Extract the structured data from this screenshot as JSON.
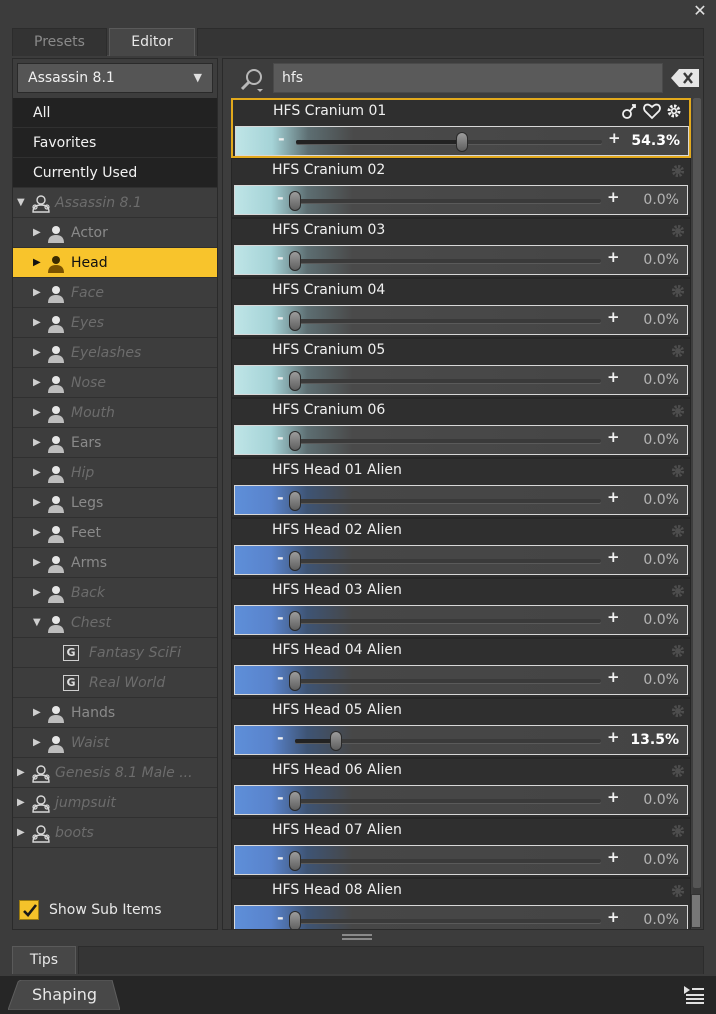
{
  "window": {
    "close_glyph": "✕"
  },
  "tabs": {
    "presets": "Presets",
    "editor": "Editor"
  },
  "figure_selector": {
    "selected": "Assassin 8.1"
  },
  "tree": {
    "top_items": [
      "All",
      "Favorites",
      "Currently Used"
    ],
    "nodes": [
      {
        "label": "Assassin 8.1",
        "icon": "figure-outline-icon",
        "level": 0,
        "arrow": "down",
        "italic": true
      },
      {
        "label": "Actor",
        "icon": "person-icon",
        "level": 1,
        "arrow": "right",
        "italic": false
      },
      {
        "label": "Head",
        "icon": "person-icon",
        "level": 1,
        "arrow": "right",
        "italic": false,
        "selected": true
      },
      {
        "label": "Face",
        "icon": "person-icon",
        "level": 1,
        "arrow": "right",
        "italic": true
      },
      {
        "label": "Eyes",
        "icon": "person-icon",
        "level": 1,
        "arrow": "right",
        "italic": true
      },
      {
        "label": "Eyelashes",
        "icon": "person-icon",
        "level": 1,
        "arrow": "right",
        "italic": true
      },
      {
        "label": "Nose",
        "icon": "person-icon",
        "level": 1,
        "arrow": "right",
        "italic": true
      },
      {
        "label": "Mouth",
        "icon": "person-icon",
        "level": 1,
        "arrow": "right",
        "italic": true
      },
      {
        "label": "Ears",
        "icon": "person-icon",
        "level": 1,
        "arrow": "right",
        "italic": false
      },
      {
        "label": "Hip",
        "icon": "person-icon",
        "level": 1,
        "arrow": "right",
        "italic": true
      },
      {
        "label": "Legs",
        "icon": "person-icon",
        "level": 1,
        "arrow": "right",
        "italic": false
      },
      {
        "label": "Feet",
        "icon": "person-icon",
        "level": 1,
        "arrow": "right",
        "italic": false
      },
      {
        "label": "Arms",
        "icon": "person-icon",
        "level": 1,
        "arrow": "right",
        "italic": false
      },
      {
        "label": "Back",
        "icon": "person-icon",
        "level": 1,
        "arrow": "right",
        "italic": true
      },
      {
        "label": "Chest",
        "icon": "person-icon",
        "level": 1,
        "arrow": "down",
        "italic": true
      },
      {
        "label": "Fantasy SciFi",
        "icon": "group-g-icon",
        "level": 2,
        "arrow": "",
        "italic": true
      },
      {
        "label": "Real World",
        "icon": "group-g-icon",
        "level": 2,
        "arrow": "",
        "italic": true
      },
      {
        "label": "Hands",
        "icon": "person-icon",
        "level": 1,
        "arrow": "right",
        "italic": false
      },
      {
        "label": "Waist",
        "icon": "person-icon",
        "level": 1,
        "arrow": "right",
        "italic": true
      },
      {
        "label": "Genesis 8.1 Male ...",
        "icon": "figure-outline-icon",
        "level": 0,
        "arrow": "right",
        "italic": true
      },
      {
        "label": "jumpsuit",
        "icon": "figure-outline-icon",
        "level": 0,
        "arrow": "right",
        "italic": true
      },
      {
        "label": "boots",
        "icon": "figure-outline-icon",
        "level": 0,
        "arrow": "right",
        "italic": true
      }
    ]
  },
  "show_sub_items": {
    "label": "Show Sub Items",
    "checked": true
  },
  "search": {
    "value": "hfs"
  },
  "sliders": [
    {
      "name": "HFS Cranium 01",
      "value": 54.3,
      "display": "54.3%",
      "kind": "cranium",
      "active": true
    },
    {
      "name": "HFS Cranium 02",
      "value": 0,
      "display": "0.0%",
      "kind": "cranium"
    },
    {
      "name": "HFS Cranium 03",
      "value": 0,
      "display": "0.0%",
      "kind": "cranium"
    },
    {
      "name": "HFS Cranium 04",
      "value": 0,
      "display": "0.0%",
      "kind": "cranium"
    },
    {
      "name": "HFS Cranium 05",
      "value": 0,
      "display": "0.0%",
      "kind": "cranium"
    },
    {
      "name": "HFS Cranium 06",
      "value": 0,
      "display": "0.0%",
      "kind": "cranium"
    },
    {
      "name": "HFS Head 01 Alien",
      "value": 0,
      "display": "0.0%",
      "kind": "alien"
    },
    {
      "name": "HFS Head 02 Alien",
      "value": 0,
      "display": "0.0%",
      "kind": "alien"
    },
    {
      "name": "HFS Head 03 Alien",
      "value": 0,
      "display": "0.0%",
      "kind": "alien"
    },
    {
      "name": "HFS Head 04 Alien",
      "value": 0,
      "display": "0.0%",
      "kind": "alien"
    },
    {
      "name": "HFS Head 05 Alien",
      "value": 13.5,
      "display": "13.5%",
      "kind": "alien"
    },
    {
      "name": "HFS Head 06 Alien",
      "value": 0,
      "display": "0.0%",
      "kind": "alien"
    },
    {
      "name": "HFS Head 07 Alien",
      "value": 0,
      "display": "0.0%",
      "kind": "alien"
    },
    {
      "name": "HFS Head 08 Alien",
      "value": 0,
      "display": "0.0%",
      "kind": "alien"
    }
  ],
  "slider_glyphs": {
    "minus": "-",
    "plus": "+"
  },
  "bottom_tabs": {
    "tips": "Tips",
    "shaping": "Shaping"
  },
  "colors": {
    "accent": "#f8c42c",
    "active_border": "#e2a91c",
    "cranium_bar": "#bfe5e7",
    "alien_bar": "#5e8fd9"
  }
}
